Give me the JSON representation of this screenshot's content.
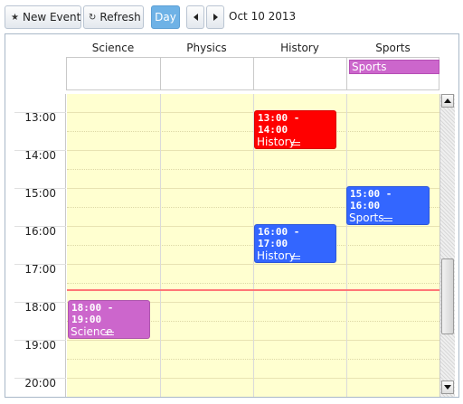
{
  "toolbar": {
    "new_event_label": "New Event",
    "refresh_label": "Refresh",
    "day_label": "Day",
    "date_label": "Oct 10 2013"
  },
  "columns": [
    "Science",
    "Physics",
    "History",
    "Sports"
  ],
  "all_day_events": [
    {
      "column": "Sports",
      "title": "Sports",
      "color": "#cc66cc"
    }
  ],
  "hours": [
    "13:00",
    "14:00",
    "15:00",
    "16:00",
    "17:00",
    "18:00",
    "19:00",
    "20:00"
  ],
  "events": [
    {
      "column": "History",
      "time": "13:00 - 14:00",
      "title": "History",
      "color": "#ff0000"
    },
    {
      "column": "Sports",
      "time": "15:00 - 16:00",
      "title": "Sports",
      "color": "#3366ff"
    },
    {
      "column": "History",
      "time": "16:00 - 17:00",
      "title": "History",
      "color": "#3366ff"
    },
    {
      "column": "Science",
      "time": "18:00 - 19:00",
      "title": "Science",
      "color": "#cc66cc"
    }
  ],
  "colors": {
    "grid_background": "#ffffd0",
    "now_line": "#ff7777",
    "active_view": "#6eb2e6"
  }
}
